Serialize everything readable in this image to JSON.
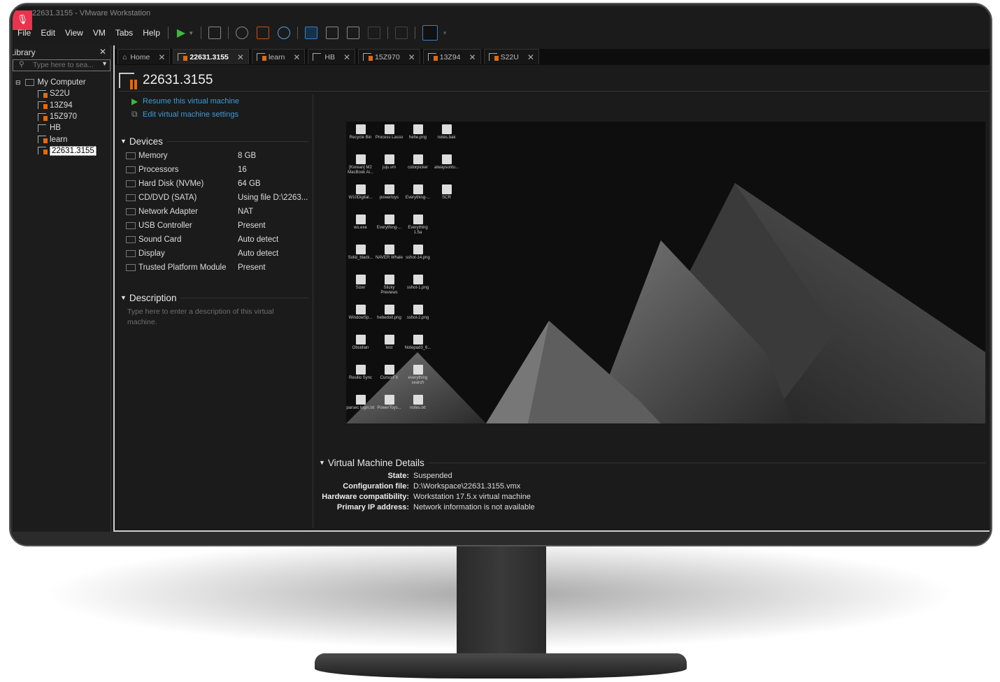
{
  "window": {
    "title": "22631.3155 - VMware Workstation"
  },
  "menu": [
    "File",
    "Edit",
    "View",
    "VM",
    "Tabs",
    "Help"
  ],
  "library": {
    "title": "Library",
    "search_placeholder": "Type here to sea...",
    "root": "My Computer",
    "items": [
      "S22U",
      "13Z94",
      "15Z970",
      "HB",
      "learn",
      "22631.3155"
    ],
    "selected": "22631.3155"
  },
  "tabs": [
    {
      "label": "Home"
    },
    {
      "label": "22631.3155",
      "active": true
    },
    {
      "label": "learn"
    },
    {
      "label": "HB"
    },
    {
      "label": "15Z970"
    },
    {
      "label": "13Z94"
    },
    {
      "label": "S22U"
    }
  ],
  "vm": {
    "name": "22631.3155",
    "actions": [
      "Resume this virtual machine",
      "Edit virtual machine settings"
    ],
    "devices_title": "Devices",
    "devices": [
      {
        "name": "Memory",
        "value": "8 GB"
      },
      {
        "name": "Processors",
        "value": "16"
      },
      {
        "name": "Hard Disk (NVMe)",
        "value": "64 GB"
      },
      {
        "name": "CD/DVD (SATA)",
        "value": "Using file D:\\2263..."
      },
      {
        "name": "Network Adapter",
        "value": "NAT"
      },
      {
        "name": "USB Controller",
        "value": "Present"
      },
      {
        "name": "Sound Card",
        "value": "Auto detect"
      },
      {
        "name": "Display",
        "value": "Auto detect"
      },
      {
        "name": "Trusted Platform Module",
        "value": "Present"
      }
    ],
    "description_title": "Description",
    "description_placeholder": "Type here to enter a description of this virtual machine.",
    "details_title": "Virtual Machine Details",
    "details": [
      {
        "key": "State:",
        "value": "Suspended"
      },
      {
        "key": "Configuration file:",
        "value": "D:\\Workspace\\22631.3155.vmx"
      },
      {
        "key": "Hardware compatibility:",
        "value": "Workstation 17.5.x virtual machine"
      },
      {
        "key": "Primary IP address:",
        "value": "Network information is not available"
      }
    ]
  },
  "desktop_icons": [
    [
      "Recycle Bin",
      "Process Lasso",
      "hehe.png",
      "notes.bak"
    ],
    [
      "[Korean] M2 MacBook Ai...",
      "juju.vm",
      "colorpicker",
      "alwaysonto..."
    ],
    [
      "W10Digital...",
      "powertoys",
      "Everything-...",
      "SCR"
    ],
    [
      "ws.exe",
      "Everything-...",
      "Everything 1.5a",
      ""
    ],
    [
      "Solid_black...",
      "NAVER Whale",
      "sshot-14.png",
      ""
    ],
    [
      "Sizer",
      "Sticky Previews",
      "sshot-1.png",
      ""
    ],
    [
      "WindowSp...",
      "hebedoit.png",
      "sshot-2.png",
      ""
    ],
    [
      "Obsidian",
      "test",
      "Notepad3_6...",
      ""
    ],
    [
      "Resilio Sync",
      "CursorFX",
      "everything search",
      ""
    ],
    [
      "parsec login.txt",
      "PowerToys...",
      "notes.txt",
      ""
    ]
  ],
  "colors": {
    "link": "#3d9ad8",
    "accent_orange": "#e06a10",
    "play_green": "#3db83d",
    "mic_badge": "#e8344c"
  }
}
